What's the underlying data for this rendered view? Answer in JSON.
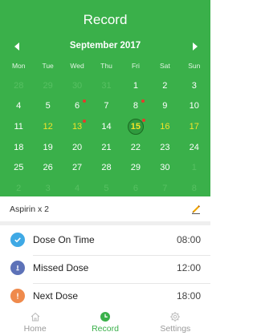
{
  "header": {
    "title": "Record"
  },
  "calendar": {
    "month_label": "September 2017",
    "weekdays": [
      "Mon",
      "Tue",
      "Wed",
      "Thu",
      "Fri",
      "Sat",
      "Sun"
    ],
    "days": [
      {
        "d": "28",
        "t": "other"
      },
      {
        "d": "29",
        "t": "other"
      },
      {
        "d": "30",
        "t": "other"
      },
      {
        "d": "31",
        "t": "other"
      },
      {
        "d": "1",
        "t": "cur"
      },
      {
        "d": "2",
        "t": "cur"
      },
      {
        "d": "3",
        "t": "cur"
      },
      {
        "d": "4",
        "t": "cur"
      },
      {
        "d": "5",
        "t": "cur"
      },
      {
        "d": "6",
        "t": "cur",
        "dot": true
      },
      {
        "d": "7",
        "t": "cur"
      },
      {
        "d": "8",
        "t": "cur",
        "dot": true
      },
      {
        "d": "9",
        "t": "cur"
      },
      {
        "d": "10",
        "t": "cur"
      },
      {
        "d": "11",
        "t": "cur"
      },
      {
        "d": "12",
        "t": "hl"
      },
      {
        "d": "13",
        "t": "hl",
        "dot": true
      },
      {
        "d": "14",
        "t": "cur"
      },
      {
        "d": "15",
        "t": "hl",
        "dot": true,
        "selected": true
      },
      {
        "d": "16",
        "t": "hl"
      },
      {
        "d": "17",
        "t": "hl"
      },
      {
        "d": "18",
        "t": "cur"
      },
      {
        "d": "19",
        "t": "cur"
      },
      {
        "d": "20",
        "t": "cur"
      },
      {
        "d": "21",
        "t": "cur"
      },
      {
        "d": "22",
        "t": "cur"
      },
      {
        "d": "23",
        "t": "cur"
      },
      {
        "d": "24",
        "t": "cur"
      },
      {
        "d": "25",
        "t": "cur"
      },
      {
        "d": "26",
        "t": "cur"
      },
      {
        "d": "27",
        "t": "cur"
      },
      {
        "d": "28",
        "t": "cur"
      },
      {
        "d": "29",
        "t": "cur"
      },
      {
        "d": "30",
        "t": "cur"
      },
      {
        "d": "1",
        "t": "other"
      },
      {
        "d": "2",
        "t": "other"
      },
      {
        "d": "3",
        "t": "other"
      },
      {
        "d": "4",
        "t": "other"
      },
      {
        "d": "5",
        "t": "other"
      },
      {
        "d": "6",
        "t": "other"
      },
      {
        "d": "7",
        "t": "other"
      },
      {
        "d": "8",
        "t": "other"
      }
    ]
  },
  "medicine": {
    "name": "Aspirin x 2",
    "edit_icon": "pencil-icon"
  },
  "legend": [
    {
      "label": "Dose On Time",
      "time": "08:00",
      "color": "#3fa9e5",
      "icon": "check-icon"
    },
    {
      "label": "Missed Dose",
      "time": "12:00",
      "color": "#5d72b8",
      "icon": "info-icon"
    },
    {
      "label": "Next Dose",
      "time": "18:00",
      "color": "#ef8a4c",
      "icon": "exclamation-icon"
    }
  ],
  "tabs": [
    {
      "label": "Home",
      "icon": "home-icon",
      "active": false
    },
    {
      "label": "Record",
      "icon": "clock-icon",
      "active": true
    },
    {
      "label": "Settings",
      "icon": "gear-icon",
      "active": false
    }
  ],
  "colors": {
    "primary_green": "#3ab04a",
    "highlight_yellow": "#f2e32a",
    "dot_red": "#e53b2b",
    "inactive_gray": "#9a9a9a"
  }
}
